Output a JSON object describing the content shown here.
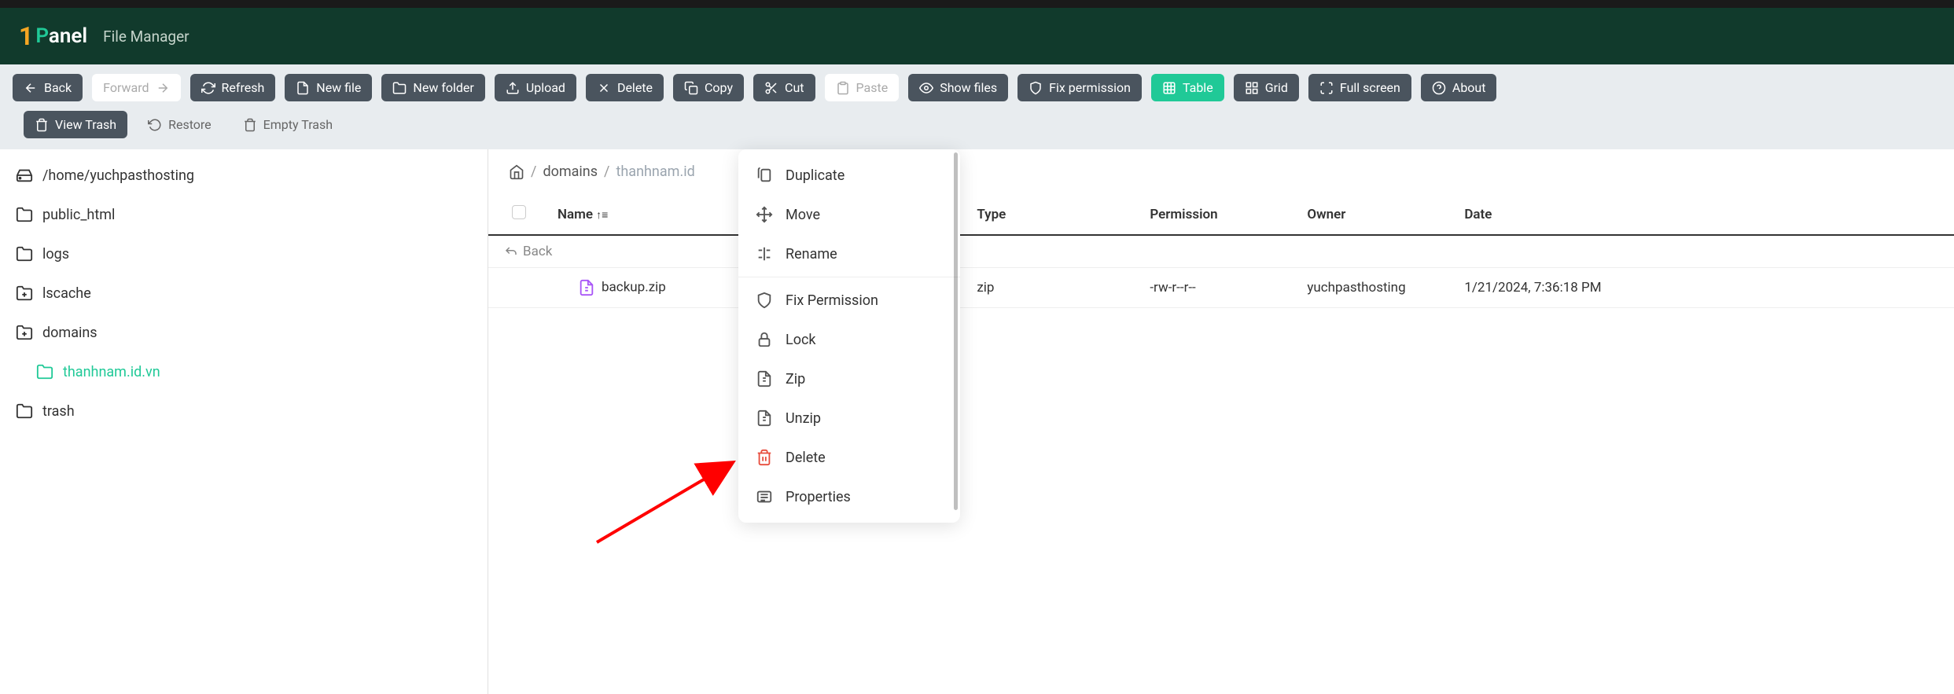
{
  "header": {
    "logo_prefix": "1",
    "logo_rest": "anel",
    "title": "File Manager"
  },
  "toolbar": {
    "back": "Back",
    "forward": "Forward",
    "refresh": "Refresh",
    "new_file": "New file",
    "new_folder": "New folder",
    "upload": "Upload",
    "delete": "Delete",
    "copy": "Copy",
    "cut": "Cut",
    "paste": "Paste",
    "show_files": "Show files",
    "fix_permission": "Fix permission",
    "table": "Table",
    "grid": "Grid",
    "full_screen": "Full screen",
    "about": "About",
    "view_trash": "View Trash",
    "restore": "Restore",
    "empty_trash": "Empty Trash"
  },
  "sidebar": {
    "root": "/home/yuchpasthosting",
    "items": [
      {
        "label": "public_html"
      },
      {
        "label": "logs"
      },
      {
        "label": "lscache"
      },
      {
        "label": "domains"
      },
      {
        "label": "thanhnam.id.vn",
        "active": true
      },
      {
        "label": "trash"
      }
    ]
  },
  "breadcrumb": {
    "sep": "/",
    "domains": "domains",
    "current": "thanhnam.id"
  },
  "table": {
    "headers": {
      "name": "Name",
      "type": "Type",
      "permission": "Permission",
      "owner": "Owner",
      "date": "Date"
    },
    "back_label": "Back",
    "rows": [
      {
        "name": "backup.zip",
        "type": "zip",
        "permission": "-rw-r--r--",
        "owner": "yuchpasthosting",
        "date": "1/21/2024, 7:36:18 PM"
      }
    ]
  },
  "context_menu": {
    "duplicate": "Duplicate",
    "move": "Move",
    "rename": "Rename",
    "fix_permission": "Fix Permission",
    "lock": "Lock",
    "zip": "Zip",
    "unzip": "Unzip",
    "delete": "Delete",
    "properties": "Properties"
  }
}
